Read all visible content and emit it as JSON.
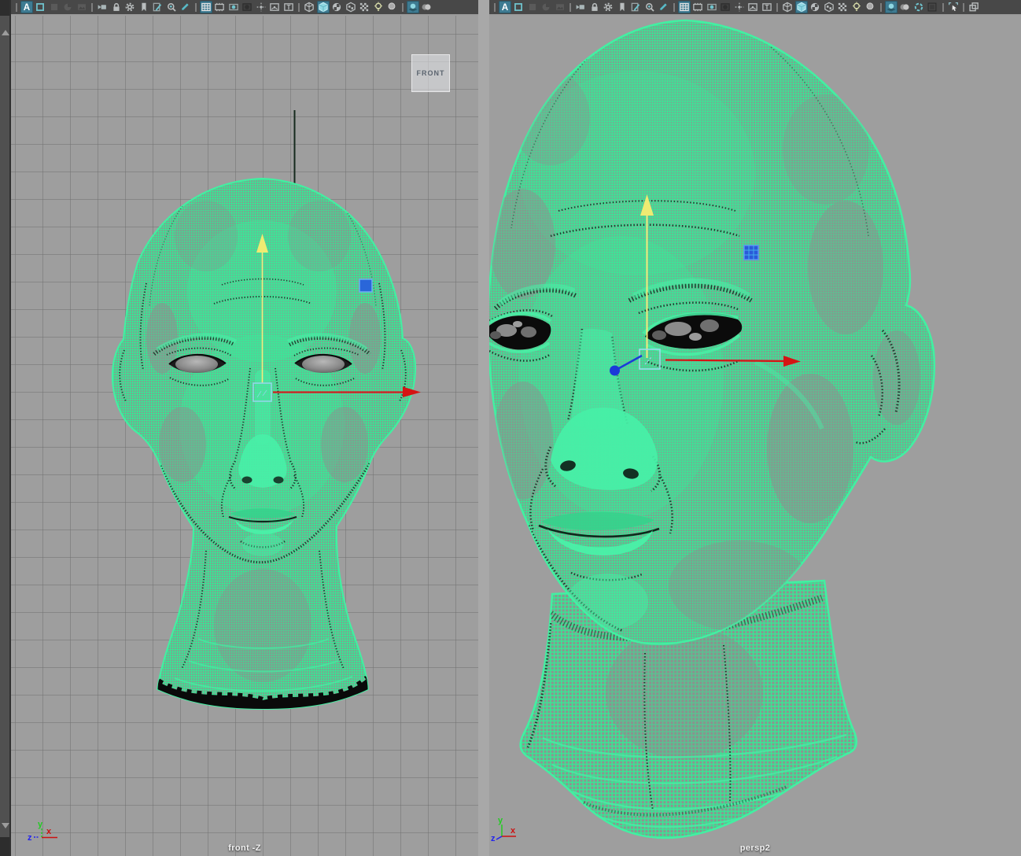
{
  "window": {
    "background": "#9e9e9e",
    "toolbar_background": "#484848",
    "accent_teal": "#6fc3cd",
    "active_icon_background": "#3e7b92",
    "mesh_green": "#3ce294",
    "grid_line": "#6f6f6f",
    "manipulator": {
      "x_axis_color": "#d51414",
      "active_axis_color": "#f1ee7d",
      "z_axis_color": "#1b3ad8",
      "center_color": "#8fd9e8",
      "plane_handle_color": "#2a5ad9"
    }
  },
  "panels": [
    {
      "id": "front",
      "camera_label": "front -Z",
      "view_badge": "FRONT",
      "axis_labels": {
        "x": "x",
        "y": "y",
        "z": "z"
      },
      "toolbar": [
        {
          "type": "sep"
        },
        {
          "name": "a-display-icon",
          "type": "a",
          "state": "active",
          "glyph": "A"
        },
        {
          "name": "select-outline-icon",
          "type": "osq",
          "state": "normal"
        },
        {
          "name": "solid-square-icon",
          "type": "fsq",
          "state": "dim"
        },
        {
          "name": "pie-sphere-icon",
          "type": "pie",
          "state": "dim"
        },
        {
          "name": "image-plane-icon",
          "type": "img",
          "state": "dim"
        },
        {
          "type": "sep"
        },
        {
          "name": "select-camera-icon",
          "type": "cam",
          "state": "normal"
        },
        {
          "name": "lock-camera-icon",
          "type": "lock",
          "state": "normal"
        },
        {
          "name": "camera-attributes-icon",
          "type": "gear",
          "state": "normal"
        },
        {
          "name": "bookmark-icon",
          "type": "bkm",
          "state": "normal"
        },
        {
          "name": "grease-pencil-icon",
          "type": "gpen",
          "state": "normal"
        },
        {
          "name": "pan-zoom-icon",
          "type": "pz",
          "state": "normal"
        },
        {
          "name": "pencil-icon",
          "type": "pen",
          "state": "normal"
        },
        {
          "type": "sep"
        },
        {
          "name": "grid-icon",
          "type": "grid",
          "state": "active"
        },
        {
          "name": "film-gate-icon",
          "type": "fg",
          "state": "normal"
        },
        {
          "name": "resolution-gate-icon",
          "type": "rg",
          "state": "normal"
        },
        {
          "name": "gate-mask-icon",
          "type": "gm",
          "state": "dim"
        },
        {
          "name": "field-chart-icon",
          "type": "fc",
          "state": "normal"
        },
        {
          "name": "safe-action-icon",
          "type": "sa",
          "state": "normal"
        },
        {
          "name": "safe-title-icon",
          "type": "st",
          "state": "normal",
          "glyph": "T"
        },
        {
          "type": "sep"
        },
        {
          "name": "wireframe-cube-icon",
          "type": "cw",
          "state": "normal"
        },
        {
          "name": "shaded-cube-icon",
          "type": "cs",
          "state": "active"
        },
        {
          "name": "checker-sphere-icon",
          "type": "sck",
          "state": "normal"
        },
        {
          "name": "textured-cube-icon",
          "type": "ctx",
          "state": "normal"
        },
        {
          "name": "checkerboard-icon",
          "type": "chk",
          "state": "normal"
        },
        {
          "name": "light-bulb-icon",
          "type": "blb",
          "state": "normal"
        },
        {
          "name": "shadow-sphere-icon",
          "type": "ssh",
          "state": "normal"
        },
        {
          "type": "sep"
        },
        {
          "name": "ambient-occlusion-icon",
          "type": "ao",
          "state": "active"
        },
        {
          "name": "motion-blur-icon",
          "type": "mb",
          "state": "normal"
        }
      ]
    },
    {
      "id": "persp",
      "camera_label": "persp2",
      "axis_labels": {
        "x": "x",
        "y": "y",
        "z": "z"
      },
      "toolbar": [
        {
          "type": "sep"
        },
        {
          "name": "a-display-icon",
          "type": "a",
          "state": "active",
          "glyph": "A"
        },
        {
          "name": "select-outline-icon",
          "type": "osq",
          "state": "normal"
        },
        {
          "name": "solid-square-icon",
          "type": "fsq",
          "state": "dim"
        },
        {
          "name": "pie-sphere-icon",
          "type": "pie",
          "state": "dim"
        },
        {
          "name": "image-plane-icon",
          "type": "img",
          "state": "dim"
        },
        {
          "type": "sep"
        },
        {
          "name": "select-camera-icon",
          "type": "cam",
          "state": "normal"
        },
        {
          "name": "lock-camera-icon",
          "type": "lock",
          "state": "normal"
        },
        {
          "name": "camera-attributes-icon",
          "type": "gear",
          "state": "normal"
        },
        {
          "name": "bookmark-icon",
          "type": "bkm",
          "state": "normal"
        },
        {
          "name": "grease-pencil-icon",
          "type": "gpen",
          "state": "normal"
        },
        {
          "name": "pan-zoom-icon",
          "type": "pz",
          "state": "normal"
        },
        {
          "name": "pencil-icon",
          "type": "pen",
          "state": "normal"
        },
        {
          "type": "sep"
        },
        {
          "name": "grid-icon",
          "type": "grid",
          "state": "active"
        },
        {
          "name": "film-gate-icon",
          "type": "fg",
          "state": "normal"
        },
        {
          "name": "resolution-gate-icon",
          "type": "rg",
          "state": "normal"
        },
        {
          "name": "gate-mask-icon",
          "type": "gm",
          "state": "dim"
        },
        {
          "name": "field-chart-icon",
          "type": "fc",
          "state": "normal"
        },
        {
          "name": "safe-action-icon",
          "type": "sa",
          "state": "normal"
        },
        {
          "name": "safe-title-icon",
          "type": "st",
          "state": "normal",
          "glyph": "T"
        },
        {
          "type": "sep"
        },
        {
          "name": "wireframe-cube-icon",
          "type": "cw",
          "state": "normal"
        },
        {
          "name": "shaded-cube-icon",
          "type": "cs",
          "state": "active"
        },
        {
          "name": "checker-sphere-icon",
          "type": "sck",
          "state": "normal"
        },
        {
          "name": "textured-cube-icon",
          "type": "ctx",
          "state": "normal"
        },
        {
          "name": "checkerboard-icon",
          "type": "chk",
          "state": "normal"
        },
        {
          "name": "light-bulb-icon",
          "type": "blb",
          "state": "normal"
        },
        {
          "name": "shadow-sphere-icon",
          "type": "ssh",
          "state": "normal"
        },
        {
          "type": "sep"
        },
        {
          "name": "ambient-occlusion-icon",
          "type": "ao",
          "state": "active"
        },
        {
          "name": "motion-blur-icon",
          "type": "mb",
          "state": "normal"
        },
        {
          "name": "anti-aliasing-icon",
          "type": "sw",
          "state": "normal"
        },
        {
          "name": "depth-square-icon",
          "type": "dsq",
          "state": "dim"
        },
        {
          "type": "sep"
        },
        {
          "name": "isolate-select-icon",
          "type": "iso",
          "state": "normal"
        },
        {
          "type": "sep"
        },
        {
          "name": "layered-view-icon",
          "type": "lay",
          "state": "normal"
        }
      ]
    }
  ]
}
